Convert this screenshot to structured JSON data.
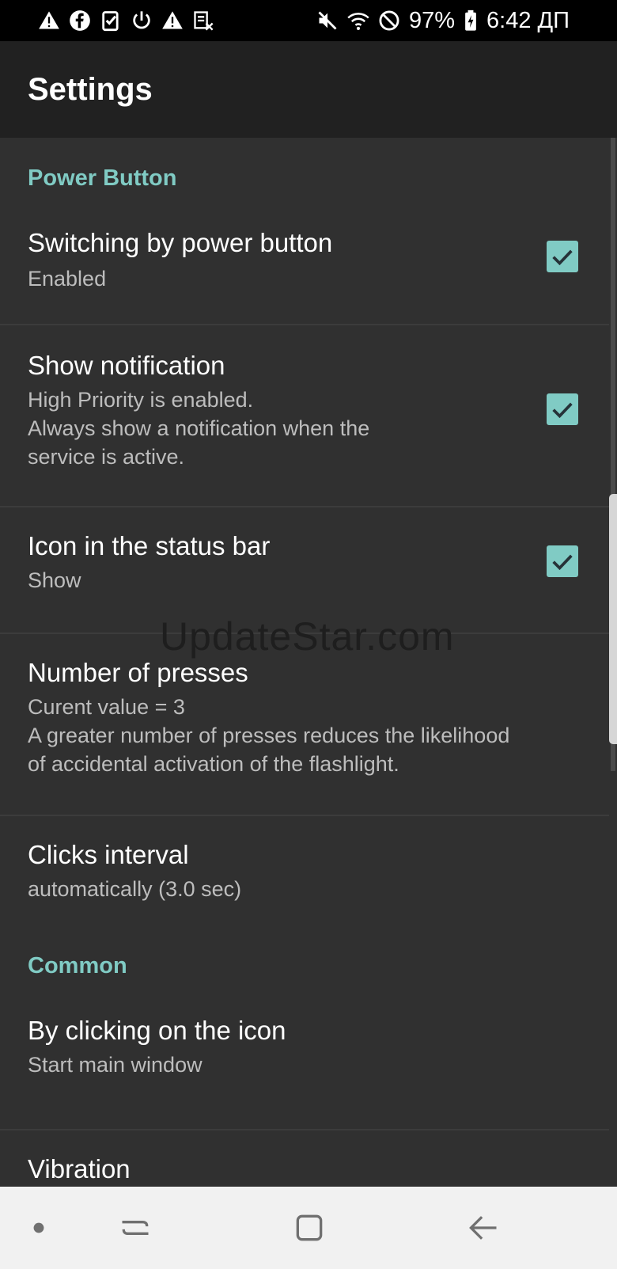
{
  "status_bar": {
    "left_icons": [
      "warning-icon",
      "facebook-icon",
      "task-check-icon",
      "power-icon",
      "warning-icon",
      "screenshot-icon"
    ],
    "right_icons": [
      "mute-icon",
      "wifi-icon",
      "do-not-disturb-icon"
    ],
    "battery_percent": "97%",
    "time": "6:42 ДП"
  },
  "app_bar": {
    "title": "Settings"
  },
  "sections": [
    {
      "header": "Power Button",
      "items": [
        {
          "title": "Switching by power button",
          "summary": "Enabled",
          "checked": true
        },
        {
          "title": "Show notification",
          "summary": "High Priority is enabled.\nAlways show a notification when the\nservice is active.",
          "checked": true
        },
        {
          "title": "Icon in the status bar",
          "summary": "Show",
          "checked": true
        },
        {
          "title": "Number of presses",
          "summary": "Curent value = 3\nA greater number of presses reduces the likelihood\nof accidental activation of the flashlight."
        },
        {
          "title": "Clicks interval",
          "summary": "automatically (3.0 sec)"
        }
      ]
    },
    {
      "header": "Common",
      "items": [
        {
          "title": "By clicking on the icon",
          "summary": "Start main window"
        },
        {
          "title": "Vibration"
        }
      ]
    }
  ],
  "watermark": "UpdateStar.com",
  "nav_bar": {
    "buttons": [
      "dot-icon",
      "recent-apps-icon",
      "home-icon",
      "back-icon"
    ]
  },
  "colors": {
    "accent": "#80cbc4",
    "background": "#303030",
    "app_bar": "#212121",
    "status_bar": "#000000",
    "nav_bar": "#f1f1f1"
  }
}
